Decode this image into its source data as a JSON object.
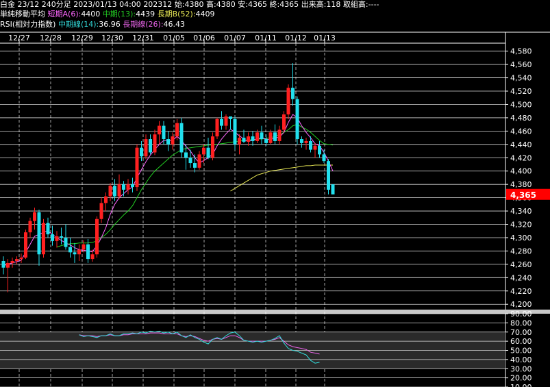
{
  "header": {
    "instrument": "白金 23/12 240分足",
    "datetime": "2023/01/13 04:00",
    "contract": "202312",
    "open_label": "始:",
    "open": "4380",
    "high_label": "高:",
    "high": "4380",
    "low_label": "安:",
    "low": "4365",
    "close_label": "終:",
    "close": "4365",
    "volume_label": "出来高:",
    "volume": "118",
    "oi_label": "取組高:",
    "oi": "----",
    "ma_title": "単純移動平均",
    "ma_short_label": "短期A(6):",
    "ma_short_value": "4400",
    "ma_mid_label": "中期(13):",
    "ma_mid_value": "4439",
    "ma_long_label": "長期B(52):",
    "ma_long_value": "4409",
    "rsi_title": "RSI(相対力指数)",
    "rsi_mid_label": "中期線(14):",
    "rsi_mid_value": "36.96",
    "rsi_long_label": "長期線(26):",
    "rsi_long_value": "46.43"
  },
  "colors": {
    "up": "#ff2020",
    "down": "#22e0ee",
    "ma_short": "#ff66ff",
    "ma_mid": "#22cc22",
    "ma_long": "#e8e855",
    "rsi_mid": "#33dddd",
    "rsi_long": "#ee66ee",
    "price_tag": "#ff0000"
  },
  "chart_data": {
    "type": "candlestick",
    "dates": [
      "12/27",
      "12/28",
      "12/29",
      "12/30",
      "12/31",
      "01/05",
      "01/06",
      "01/07",
      "01/11",
      "01/12",
      "01/13"
    ],
    "price_axis": {
      "ylim": [
        4192,
        4592
      ],
      "ticks": [
        "4,580",
        "4,560",
        "4,540",
        "4,520",
        "4,500",
        "4,480",
        "4,460",
        "4,440",
        "4,420",
        "4,400",
        "4,380",
        "4,360",
        "4,340",
        "4,320",
        "4,300",
        "4,280",
        "4,260",
        "4,240",
        "4,220",
        "4,200"
      ]
    },
    "last_price_label": "4,365",
    "last_price": 4365,
    "candles": [
      [
        4265,
        4272,
        4245,
        4255
      ],
      [
        4255,
        4268,
        4218,
        4262
      ],
      [
        4262,
        4270,
        4255,
        4265
      ],
      [
        4265,
        4272,
        4260,
        4268
      ],
      [
        4268,
        4276,
        4262,
        4270
      ],
      [
        4270,
        4312,
        4268,
        4308
      ],
      [
        4308,
        4330,
        4300,
        4325
      ],
      [
        4325,
        4345,
        4312,
        4338
      ],
      [
        4338,
        4342,
        4258,
        4275
      ],
      [
        4275,
        4328,
        4270,
        4322
      ],
      [
        4322,
        4330,
        4300,
        4305
      ],
      [
        4305,
        4318,
        4288,
        4295
      ],
      [
        4295,
        4310,
        4285,
        4302
      ],
      [
        4302,
        4315,
        4290,
        4300
      ],
      [
        4300,
        4320,
        4282,
        4286
      ],
      [
        4286,
        4300,
        4270,
        4278
      ],
      [
        4278,
        4292,
        4262,
        4275
      ],
      [
        4275,
        4290,
        4265,
        4282
      ],
      [
        4282,
        4296,
        4278,
        4290
      ],
      [
        4290,
        4298,
        4262,
        4268
      ],
      [
        4268,
        4282,
        4264,
        4275
      ],
      [
        4275,
        4332,
        4270,
        4328
      ],
      [
        4328,
        4360,
        4322,
        4352
      ],
      [
        4352,
        4368,
        4340,
        4362
      ],
      [
        4362,
        4382,
        4355,
        4378
      ],
      [
        4378,
        4388,
        4355,
        4362
      ],
      [
        4362,
        4395,
        4358,
        4380
      ],
      [
        4380,
        4385,
        4362,
        4372
      ],
      [
        4372,
        4388,
        4365,
        4380
      ],
      [
        4380,
        4390,
        4368,
        4376
      ],
      [
        4376,
        4440,
        4370,
        4435
      ],
      [
        4435,
        4445,
        4415,
        4422
      ],
      [
        4422,
        4455,
        4418,
        4448
      ],
      [
        4448,
        4455,
        4425,
        4428
      ],
      [
        4428,
        4462,
        4424,
        4455
      ],
      [
        4455,
        4475,
        4440,
        4468
      ],
      [
        4468,
        4475,
        4440,
        4448
      ],
      [
        4448,
        4460,
        4430,
        4440
      ],
      [
        4440,
        4458,
        4432,
        4452
      ],
      [
        4452,
        4478,
        4446,
        4472
      ],
      [
        4472,
        4480,
        4420,
        4428
      ],
      [
        4428,
        4440,
        4402,
        4420
      ],
      [
        4420,
        4432,
        4405,
        4412
      ],
      [
        4412,
        4425,
        4398,
        4405
      ],
      [
        4405,
        4430,
        4402,
        4425
      ],
      [
        4425,
        4440,
        4412,
        4435
      ],
      [
        4435,
        4450,
        4418,
        4420
      ],
      [
        4420,
        4458,
        4416,
        4452
      ],
      [
        4452,
        4480,
        4448,
        4478
      ],
      [
        4478,
        4490,
        4462,
        4468
      ],
      [
        4468,
        4485,
        4462,
        4482
      ],
      [
        4482,
        4480,
        4462,
        4478
      ],
      [
        4478,
        4482,
        4432,
        4440
      ],
      [
        4440,
        4455,
        4425,
        4450
      ],
      [
        4450,
        4462,
        4442,
        4444
      ],
      [
        4444,
        4458,
        4438,
        4452
      ],
      [
        4452,
        4460,
        4438,
        4445
      ],
      [
        4445,
        4462,
        4442,
        4458
      ],
      [
        4458,
        4468,
        4440,
        4448
      ],
      [
        4448,
        4455,
        4438,
        4442
      ],
      [
        4442,
        4462,
        4440,
        4458
      ],
      [
        4458,
        4470,
        4440,
        4445
      ],
      [
        4445,
        4468,
        4440,
        4462
      ],
      [
        4462,
        4490,
        4458,
        4485
      ],
      [
        4485,
        4530,
        4478,
        4525
      ],
      [
        4525,
        4562,
        4498,
        4508
      ],
      [
        4508,
        4512,
        4440,
        4448
      ],
      [
        4448,
        4452,
        4435,
        4442
      ],
      [
        4442,
        4450,
        4432,
        4445
      ],
      [
        4445,
        4452,
        4428,
        4432
      ],
      [
        4432,
        4442,
        4420,
        4438
      ],
      [
        4438,
        4445,
        4420,
        4425
      ],
      [
        4425,
        4432,
        4412,
        4415
      ],
      [
        4415,
        4418,
        4365,
        4372
      ],
      [
        4380,
        4380,
        4365,
        4365
      ]
    ],
    "ma_short": [
      4258,
      4260,
      4262,
      4264,
      4266,
      4278,
      4290,
      4302,
      4305,
      4308,
      4310,
      4305,
      4300,
      4296,
      4292,
      4289,
      4285,
      4282,
      4281,
      4280,
      4279,
      4288,
      4300,
      4315,
      4335,
      4350,
      4360,
      4366,
      4372,
      4376,
      4390,
      4402,
      4414,
      4424,
      4432,
      4440,
      4446,
      4446,
      4446,
      4452,
      4446,
      4437,
      4430,
      4420,
      4412,
      4416,
      4420,
      4425,
      4438,
      4448,
      4456,
      4463,
      4458,
      4453,
      4448,
      4444,
      4447,
      4448,
      4450,
      4448,
      4447,
      4450,
      4451,
      4458,
      4473,
      4485,
      4480,
      4468,
      4458,
      4450,
      4441,
      4438,
      4428,
      4415,
      4400
    ],
    "ma_mid": [
      null,
      null,
      null,
      null,
      null,
      null,
      null,
      null,
      null,
      null,
      null,
      null,
      4286,
      4288,
      4290,
      4291,
      4291,
      4292,
      4292,
      4292,
      4293,
      4295,
      4300,
      4305,
      4312,
      4320,
      4327,
      4334,
      4340,
      4348,
      4360,
      4372,
      4382,
      4392,
      4400,
      4406,
      4412,
      4418,
      4424,
      4428,
      4432,
      4434,
      4435,
      4436,
      4437,
      4438,
      4439,
      4439,
      4440,
      4441,
      4442,
      4443,
      4444,
      4445,
      4446,
      4447,
      4447,
      4448,
      4448,
      4449,
      4450,
      4452,
      4455,
      4458,
      4462,
      4468,
      4470,
      4466,
      4463,
      4458,
      4452,
      4446,
      4441,
      4440,
      4439
    ],
    "ma_long": [
      null,
      null,
      null,
      null,
      null,
      null,
      null,
      null,
      null,
      null,
      null,
      null,
      null,
      null,
      null,
      null,
      null,
      null,
      null,
      null,
      null,
      null,
      null,
      null,
      null,
      null,
      null,
      null,
      null,
      null,
      null,
      null,
      null,
      null,
      null,
      null,
      null,
      null,
      null,
      null,
      null,
      null,
      null,
      null,
      null,
      null,
      null,
      null,
      null,
      null,
      null,
      4370,
      4374,
      4378,
      4382,
      4386,
      4390,
      4394,
      4396,
      4398,
      4400,
      4401,
      4402,
      4403,
      4404,
      4405,
      4406,
      4407,
      4408,
      4408,
      4409,
      4409,
      4409,
      4409,
      4409
    ],
    "rsi_axis": {
      "ylim": [
        10,
        90
      ],
      "ticks": [
        "90.00",
        "80.00",
        "70.00",
        "60.00",
        "50.00",
        "40.00",
        "30.00",
        "20.00",
        "10.00"
      ],
      "bands": [
        [
          30,
          70
        ]
      ]
    },
    "rsi_mid": [
      null,
      null,
      null,
      null,
      null,
      null,
      null,
      null,
      null,
      null,
      null,
      null,
      null,
      null,
      null,
      null,
      null,
      null,
      null,
      null,
      null,
      null,
      null,
      null,
      null,
      null,
      null,
      null,
      null,
      null,
      null,
      null,
      null,
      null,
      null,
      null,
      null,
      null,
      null,
      null,
      null,
      null,
      null,
      null,
      null,
      null,
      null,
      null,
      null,
      null,
      null,
      null,
      null,
      null,
      null,
      null,
      null,
      null,
      null,
      null,
      null,
      null,
      null,
      null,
      null,
      null,
      null,
      null,
      null,
      null,
      null,
      null,
      null,
      null,
      36.96
    ],
    "rsi_mid_series": [
      67,
      65,
      66,
      65,
      64,
      66,
      66,
      68,
      66,
      66,
      68,
      68,
      69,
      68,
      70,
      69,
      71,
      70,
      71,
      69,
      70,
      68,
      70,
      66,
      64,
      67,
      64,
      62,
      59,
      57,
      62,
      64,
      62,
      66,
      69,
      70,
      66,
      61,
      60,
      59,
      60,
      59,
      60,
      61,
      63,
      66,
      58,
      52,
      50,
      49,
      47,
      45,
      39,
      36,
      37
    ],
    "rsi_long_series": [
      67,
      66,
      66,
      66,
      65,
      66,
      66,
      67,
      66,
      66,
      67,
      67,
      68,
      68,
      68,
      68,
      69,
      69,
      69,
      68,
      68,
      68,
      68,
      66,
      65,
      66,
      65,
      63,
      61,
      60,
      62,
      63,
      62,
      64,
      66,
      66,
      64,
      61,
      60,
      60,
      60,
      60,
      60,
      61,
      62,
      64,
      60,
      56,
      54,
      53,
      52,
      51,
      48,
      47,
      46
    ]
  }
}
